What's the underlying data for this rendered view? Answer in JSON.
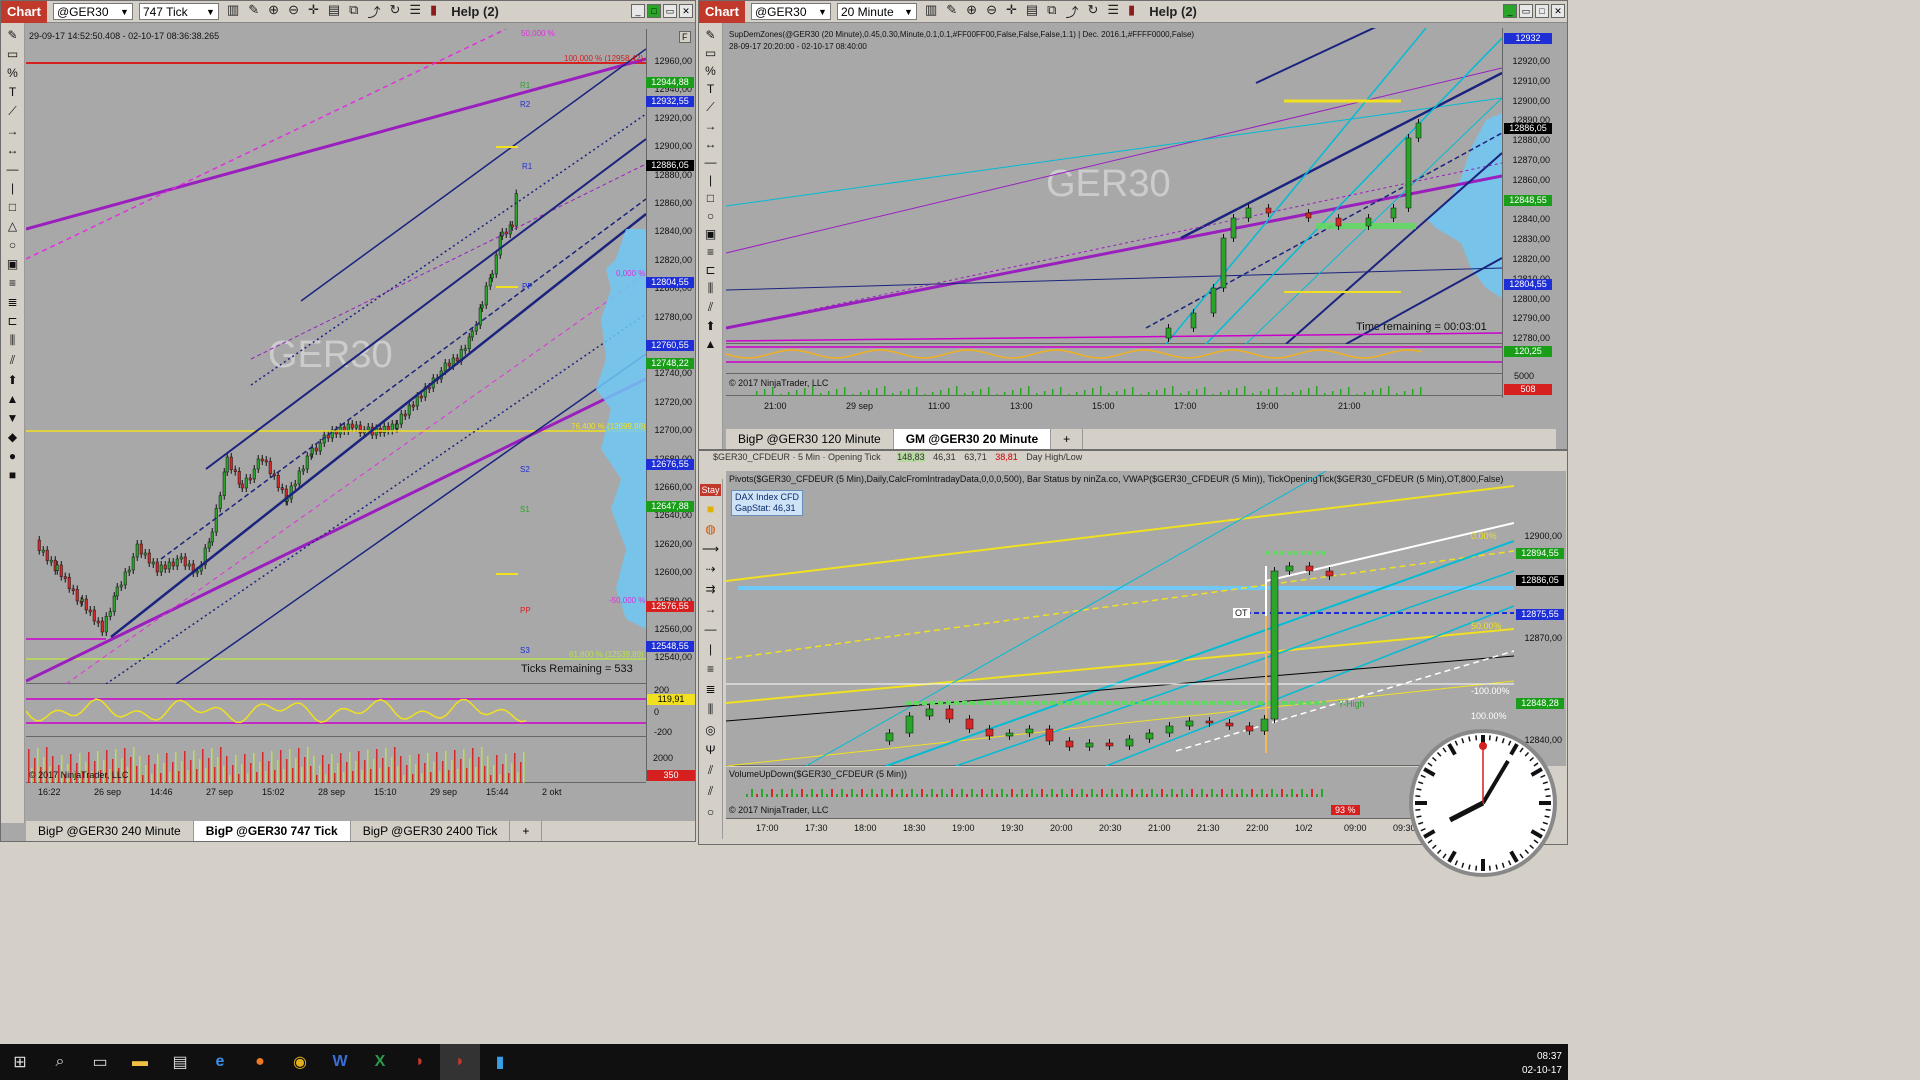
{
  "left_window": {
    "chart_tab": "Chart",
    "instrument": "@GER30",
    "period": "747 Tick",
    "help": "Help (2)",
    "info": "29-09-17 14:52:50.408 - 02-10-17 08:36:38.265",
    "watermark": "GER30",
    "ticks_remaining": "Ticks Remaining = 533",
    "copyright": "© 2017 NinjaTrader, LLC",
    "price_labels": [
      "12960,00",
      "12940,00",
      "12920,00",
      "12900,00",
      "12880,00",
      "12860,00",
      "12840,00",
      "12820,00",
      "12800,00",
      "12780,00",
      "12760,00",
      "12740,00",
      "12720,00",
      "12700,00",
      "12680,00",
      "12660,00",
      "12640,00",
      "12620,00",
      "12600,00",
      "12580,00",
      "12560,00",
      "12540,00"
    ],
    "price_tags": [
      {
        "text": "12944,88",
        "color": "#1a9e1a"
      },
      {
        "text": "12932,55",
        "color": "#1f2fd6"
      },
      {
        "text": "12886,05",
        "color": "#000000"
      },
      {
        "text": "12804,55",
        "color": "#1f2fd6"
      },
      {
        "text": "12760,55",
        "color": "#1f2fd6"
      },
      {
        "text": "12748,22",
        "color": "#1a9e1a"
      },
      {
        "text": "12676,55",
        "color": "#1f2fd6"
      },
      {
        "text": "12647,88",
        "color": "#1a9e1a"
      },
      {
        "text": "12576,55",
        "color": "#d61f1f"
      },
      {
        "text": "12548,55",
        "color": "#1f2fd6"
      }
    ],
    "level_texts": [
      "100,000 % (12958,42)",
      "50,000 %",
      "0,000 %",
      "76,400 % (12699,88)",
      "-50,000 %",
      "61,800 % (12539,89)"
    ],
    "pivot_marks": [
      "R1",
      "R2",
      "R1",
      "PP",
      "S2",
      "S1",
      "PP",
      "S3"
    ],
    "osc_labels": [
      "200",
      "0",
      "-200",
      "119,91"
    ],
    "vol_labels": [
      "2000",
      "350"
    ],
    "time_labels": [
      "16:22",
      "26 sep",
      "14:46",
      "27 sep",
      "15:02",
      "28 sep",
      "15:10",
      "29 sep",
      "15:44",
      "2 okt"
    ],
    "tabs": [
      "BigP @GER30 240 Minute",
      "BigP @GER30 747 Tick",
      "BigP @GER30 2400 Tick",
      "+"
    ]
  },
  "right_top_window": {
    "chart_tab": "Chart",
    "instrument": "@GER30",
    "period": "20 Minute",
    "help": "Help (2)",
    "indicator_line": "SupDemZones(@GER30 (20 Minute),0.45,0.30,Minute,0.1,0.1,#FF00FF00,False,False,False,1.1) | Dec. 2016.1,#FFFF0000,False)",
    "info": "28-09-17 20:20:00 - 02-10-17 08:40:00",
    "watermark": "GER30",
    "time_remaining": "Time remaining = 00:03:01",
    "copyright": "© 2017 NinjaTrader, LLC",
    "price_labels": [
      "12920,00",
      "12910,00",
      "12900,00",
      "12890,00",
      "12880,00",
      "12870,00",
      "12860,00",
      "12850,00",
      "12840,00",
      "12830,00",
      "12820,00",
      "12810,00",
      "12800,00",
      "12790,00",
      "12780,00"
    ],
    "price_tags": [
      {
        "text": "12932",
        "color": "#1f2fd6"
      },
      {
        "text": "12886,05",
        "color": "#000000"
      },
      {
        "text": "12848,55",
        "color": "#1a9e1a"
      },
      {
        "text": "12804,55",
        "color": "#1f2fd6"
      },
      {
        "text": "120,25",
        "color": "#1a9e1a"
      },
      {
        "text": "508",
        "color": "#d61f1f"
      }
    ],
    "osc_labels": [
      "5000"
    ],
    "time_labels": [
      "21:00",
      "29 sep",
      "11:00",
      "13:00",
      "15:00",
      "17:00",
      "19:00",
      "21:00"
    ],
    "tabs": [
      "BigP @GER30 120 Minute",
      "GM @GER30 20 Minute",
      "+"
    ]
  },
  "right_bottom_window": {
    "stay": "Stay",
    "topstrip": [
      "$GER30_CFDEUR",
      "5 Min",
      "Opening Tick",
      "148,83",
      "46,31",
      "63,71",
      "38,81",
      "Day High/Low"
    ],
    "indicator_line": "Pivots($GER30_CFDEUR (5 Min),Daily,CalcFromIntradayData,0,0,0,500), Bar Status by ninZa.co, VWAP($GER30_CFDEUR (5 Min)), TickOpeningTick($GER30_CFDEUR (5 Min),OT,800,False)",
    "legend_title": "DAX Index CFD",
    "legend_stat": "GapStat: 46,31",
    "ot_label": "OT",
    "yhigh": "Y-High",
    "pct_labels": [
      "0.00%",
      "50.00%",
      "-100.00%",
      "100.00%"
    ],
    "volume_label": "VolumeUpDown($GER30_CFDEUR (5 Min))",
    "copyright": "© 2017 NinjaTrader, LLC",
    "pct93": "93 %",
    "price_labels": [
      "12900,00",
      "12870,00",
      "12840,00"
    ],
    "price_tags": [
      {
        "text": "12894,55",
        "color": "#1a9e1a"
      },
      {
        "text": "12886,05",
        "color": "#000000"
      },
      {
        "text": "12875,55",
        "color": "#1f2fd6"
      },
      {
        "text": "12848,28",
        "color": "#1a9e1a"
      }
    ],
    "time_labels": [
      "17:00",
      "17:30",
      "18:00",
      "18:30",
      "19:00",
      "19:30",
      "20:00",
      "20:30",
      "21:00",
      "21:30",
      "22:00",
      "10/2",
      "09:00",
      "09:30"
    ]
  },
  "taskbar": {
    "time": "08:37",
    "date": "02-10-17",
    "icons": [
      "windows-icon",
      "search-icon",
      "task-view-icon",
      "file-explorer-icon",
      "app-icon",
      "edge-icon",
      "firefox-icon",
      "chrome-icon",
      "word-icon",
      "excel-icon",
      "ninjatrader-icon",
      "ninjatrader8-icon",
      "tws-icon"
    ]
  },
  "colors": {
    "chart_bg": "#a8a8a8",
    "up": "#2aa52a",
    "down": "#d62828",
    "accent": "#c0392b"
  }
}
